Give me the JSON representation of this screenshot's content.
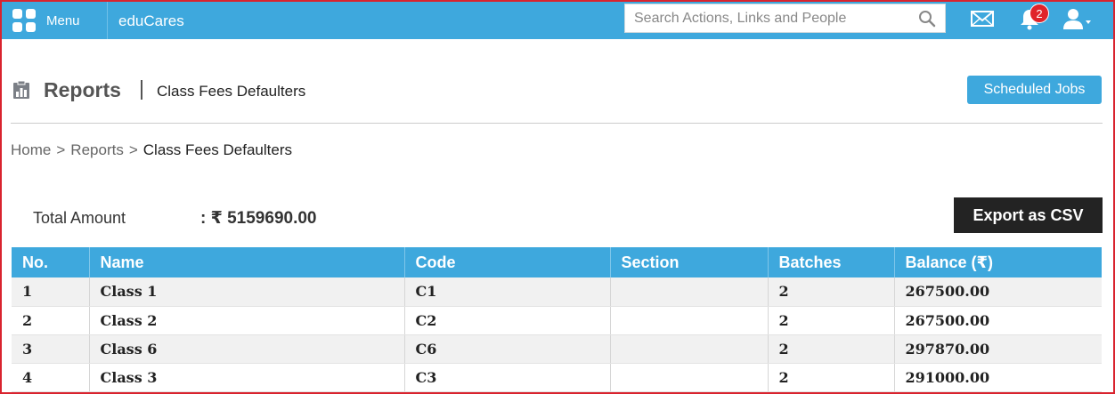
{
  "topbar": {
    "menu_label": "Menu",
    "brand": "eduCares",
    "search_placeholder": "Search Actions, Links and People",
    "notification_count": "2",
    "icons": [
      "menu-grid-icon",
      "search-icon",
      "mail-icon",
      "bell-icon",
      "user-icon"
    ],
    "bg_color": "#3ea8dd"
  },
  "header": {
    "title": "Reports",
    "subtitle": "Class Fees Defaulters",
    "scheduled_jobs_label": "Scheduled Jobs"
  },
  "breadcrumb": {
    "items": [
      "Home",
      "Reports"
    ],
    "current": "Class Fees Defaulters",
    "separator": ">"
  },
  "summary": {
    "total_label": "Total Amount",
    "total_value": ": ₹ 5159690.00",
    "export_label": "Export as CSV"
  },
  "table": {
    "columns": [
      "No.",
      "Name",
      "Code",
      "Section",
      "Batches",
      "Balance (₹)"
    ],
    "rows": [
      [
        "1",
        "Class 1",
        "C1",
        "",
        "2",
        "267500.00"
      ],
      [
        "2",
        "Class 2",
        "C2",
        "",
        "2",
        "267500.00"
      ],
      [
        "3",
        "Class 6",
        "C6",
        "",
        "2",
        "297870.00"
      ],
      [
        "4",
        "Class 3",
        "C3",
        "",
        "2",
        "291000.00"
      ]
    ]
  }
}
